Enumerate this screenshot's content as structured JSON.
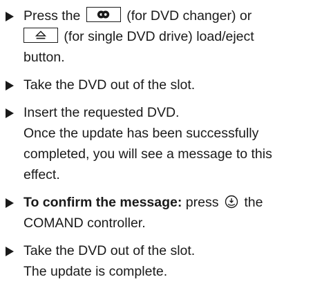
{
  "steps": [
    {
      "lines": [
        {
          "pre": "Press the",
          "post": "(for DVD changer) or"
        },
        {
          "post": "(for single DVD drive) load/eject"
        },
        {
          "text": "button."
        }
      ],
      "icons": [
        "dvd-changer-load-button-icon",
        "eject-button-icon"
      ]
    },
    {
      "lines": [
        {
          "text": "Take the DVD out of the slot."
        }
      ]
    },
    {
      "lines": [
        {
          "text": "Insert the requested DVD."
        },
        {
          "text": "Once the update has been successfully"
        },
        {
          "text": "completed, you will see a message to this"
        },
        {
          "text": "effect."
        }
      ]
    },
    {
      "lines": [
        {
          "bold": "To confirm the message:",
          "pre": "press",
          "post": "the"
        },
        {
          "text": "COMAND controller."
        }
      ],
      "icons": [
        "comand-controller-press-icon"
      ]
    },
    {
      "lines": [
        {
          "text": "Take the DVD out of the slot."
        },
        {
          "text": "The update is complete."
        }
      ]
    }
  ],
  "colors": {
    "text": "#1a1a1a",
    "background": "#ffffff"
  }
}
